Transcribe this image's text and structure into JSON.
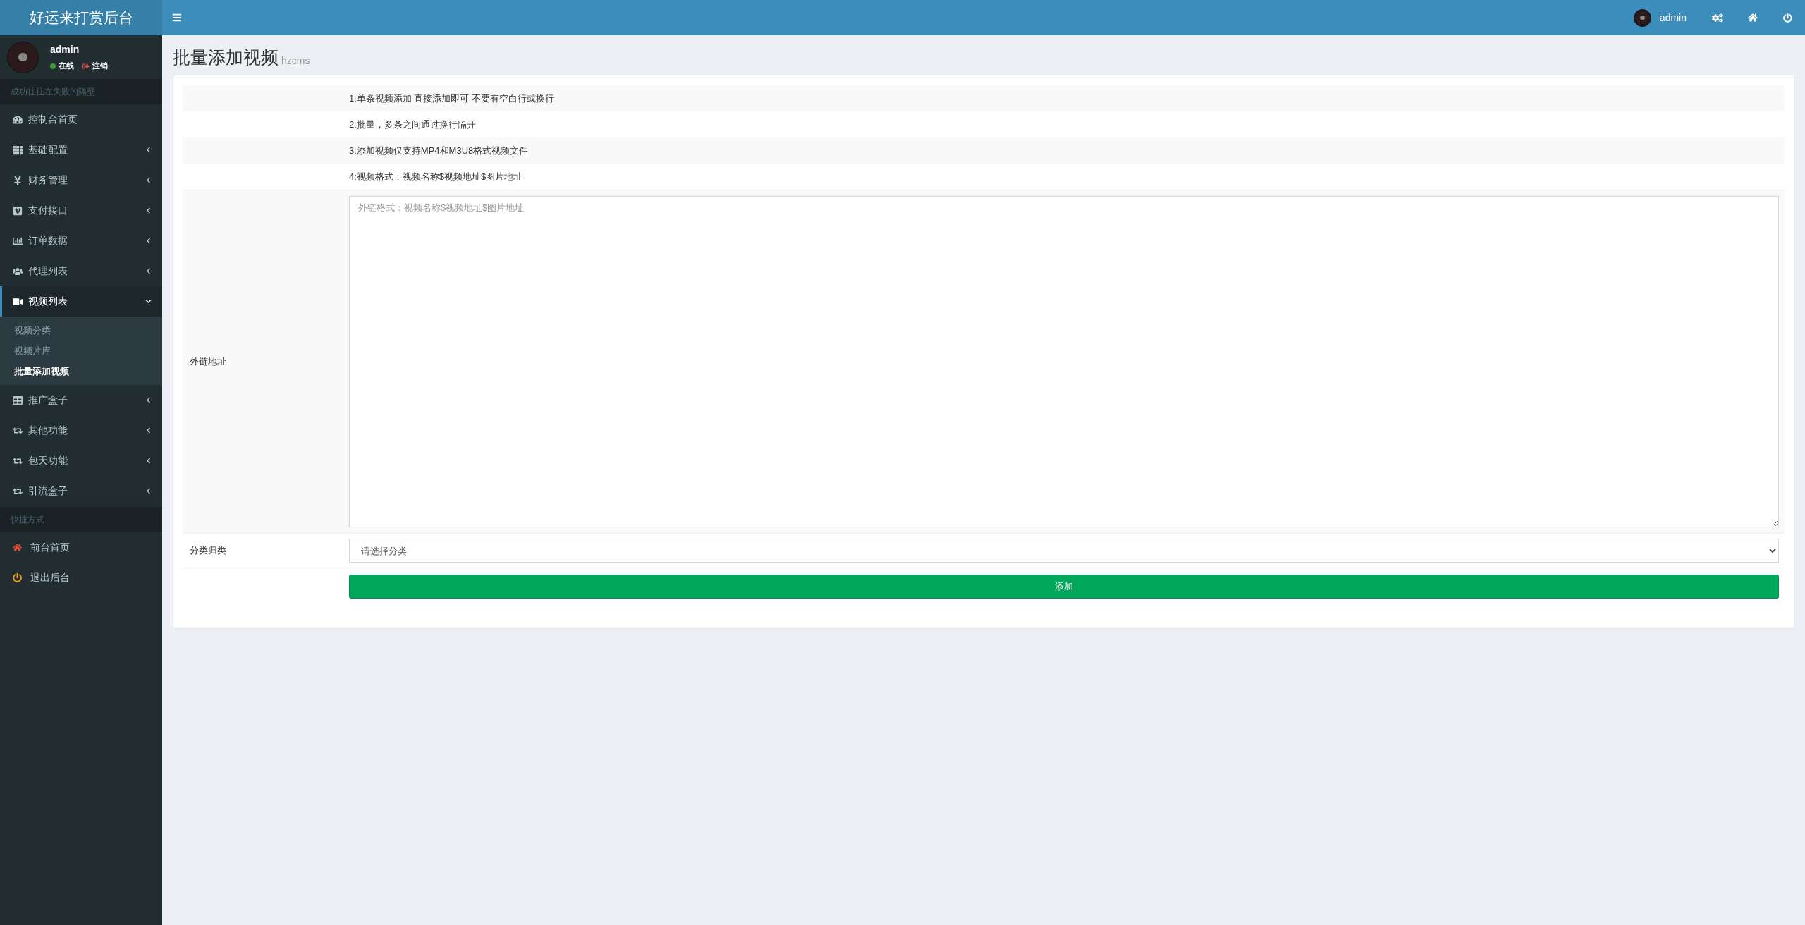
{
  "brand": "好运来打赏后台",
  "user": {
    "name": "admin",
    "status": "在线",
    "logout": "注销"
  },
  "motto": "成功往往在失败的隔壁",
  "menu": [
    {
      "kind": "link",
      "label": "控制台首页",
      "selected": false
    },
    {
      "kind": "group",
      "label": "基础配置",
      "expanded": false,
      "selected": false
    },
    {
      "kind": "group",
      "label": "财务管理",
      "expanded": false,
      "selected": false
    },
    {
      "kind": "group",
      "label": "支付接口",
      "expanded": false,
      "selected": false
    },
    {
      "kind": "group",
      "label": "订单数据",
      "expanded": false,
      "selected": false
    },
    {
      "kind": "group",
      "label": "代理列表",
      "expanded": false,
      "selected": false
    },
    {
      "kind": "group",
      "label": "视频列表",
      "expanded": true,
      "selected": true,
      "children": [
        {
          "label": "视频分类",
          "selected": false
        },
        {
          "label": "视频片库",
          "selected": false
        },
        {
          "label": "批量添加视频",
          "selected": true
        }
      ]
    },
    {
      "kind": "group",
      "label": "推广盒子",
      "expanded": false,
      "selected": false
    },
    {
      "kind": "group",
      "label": "其他功能",
      "expanded": false,
      "selected": false
    },
    {
      "kind": "group",
      "label": "包天功能",
      "expanded": false,
      "selected": false
    },
    {
      "kind": "group",
      "label": "引流盒子",
      "expanded": false,
      "selected": false
    }
  ],
  "shortcuts_header": "快捷方式",
  "shortcuts": [
    {
      "label": "前台首页"
    },
    {
      "label": "退出后台"
    }
  ],
  "topbar": {
    "user": "admin"
  },
  "page": {
    "title": "批量添加视频",
    "subtitle": "hzcms"
  },
  "notes": [
    "1:单条视频添加 直接添加即可 不要有空白行或换行",
    "2:批量，多条之间通过换行隔开",
    "3:添加视频仅支持MP4和M3U8格式视频文件",
    "4:视频格式：视频名称$视频地址$图片地址"
  ],
  "links_field": {
    "label": "外链地址",
    "placeholder": "外链格式：视频名称$视频地址$图片地址"
  },
  "category_field": {
    "label": "分类归类",
    "value": "请选择分类"
  },
  "submit": "添加"
}
